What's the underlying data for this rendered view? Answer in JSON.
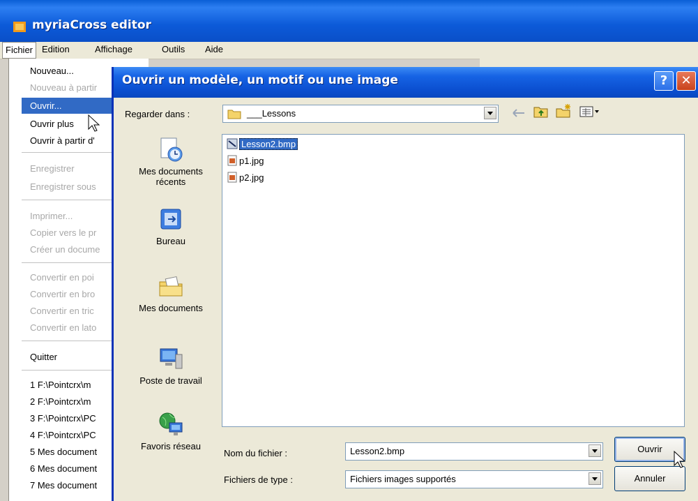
{
  "app": {
    "title": "myriaCross editor"
  },
  "menubar": {
    "items": [
      "Fichier",
      "Edition",
      "Affichage",
      "Outils",
      "Aide"
    ]
  },
  "file_menu": {
    "items": [
      {
        "label": "Nouveau...",
        "enabled": true
      },
      {
        "label": "Nouveau à partir",
        "enabled": false
      },
      {
        "label": "Ouvrir...",
        "enabled": true,
        "selected": true
      },
      {
        "label": "Ouvrir plus",
        "enabled": true
      },
      {
        "label": "Ouvrir à partir d'",
        "enabled": true
      },
      {
        "label": "Enregistrer",
        "enabled": false
      },
      {
        "label": "Enregistrer sous",
        "enabled": false
      },
      {
        "label": "Imprimer...",
        "enabled": false
      },
      {
        "label": "Copier vers le pr",
        "enabled": false
      },
      {
        "label": "Créer un docume",
        "enabled": false
      },
      {
        "label": "Convertir en poi",
        "enabled": false
      },
      {
        "label": "Convertir en bro",
        "enabled": false
      },
      {
        "label": "Convertir en tric",
        "enabled": false
      },
      {
        "label": "Convertir en lato",
        "enabled": false
      },
      {
        "label": "Quitter",
        "enabled": true
      },
      {
        "label": "1 F:\\Pointcrx\\m",
        "enabled": true
      },
      {
        "label": "2 F:\\Pointcrx\\m",
        "enabled": true
      },
      {
        "label": "3 F:\\Pointcrx\\PC",
        "enabled": true
      },
      {
        "label": "4 F:\\Pointcrx\\PC",
        "enabled": true
      },
      {
        "label": "5 Mes document",
        "enabled": true
      },
      {
        "label": "6 Mes document",
        "enabled": true
      },
      {
        "label": "7 Mes document",
        "enabled": true
      }
    ]
  },
  "dialog": {
    "title": "Ouvrir un modèle, un motif ou une image",
    "help_label": "?",
    "close_label": "✕",
    "look_in_label": "Regarder dans :",
    "look_in_value": "___Lessons",
    "places": [
      {
        "label": "Mes documents récents",
        "icon": "recent-documents-icon"
      },
      {
        "label": "Bureau",
        "icon": "desktop-icon"
      },
      {
        "label": "Mes documents",
        "icon": "my-documents-icon"
      },
      {
        "label": "Poste de travail",
        "icon": "my-computer-icon"
      },
      {
        "label": "Favoris réseau",
        "icon": "network-places-icon"
      }
    ],
    "files": [
      {
        "name": "Lesson2.bmp",
        "icon": "bmp-file-icon",
        "selected": true
      },
      {
        "name": "p1.jpg",
        "icon": "jpg-file-icon",
        "selected": false
      },
      {
        "name": "p2.jpg",
        "icon": "jpg-file-icon",
        "selected": false
      }
    ],
    "filename_label": "Nom du fichier :",
    "filename_value": "Lesson2.bmp",
    "filetype_label": "Fichiers de type :",
    "filetype_value": "Fichiers images supportés",
    "open_button": "Ouvrir",
    "cancel_button": "Annuler"
  }
}
